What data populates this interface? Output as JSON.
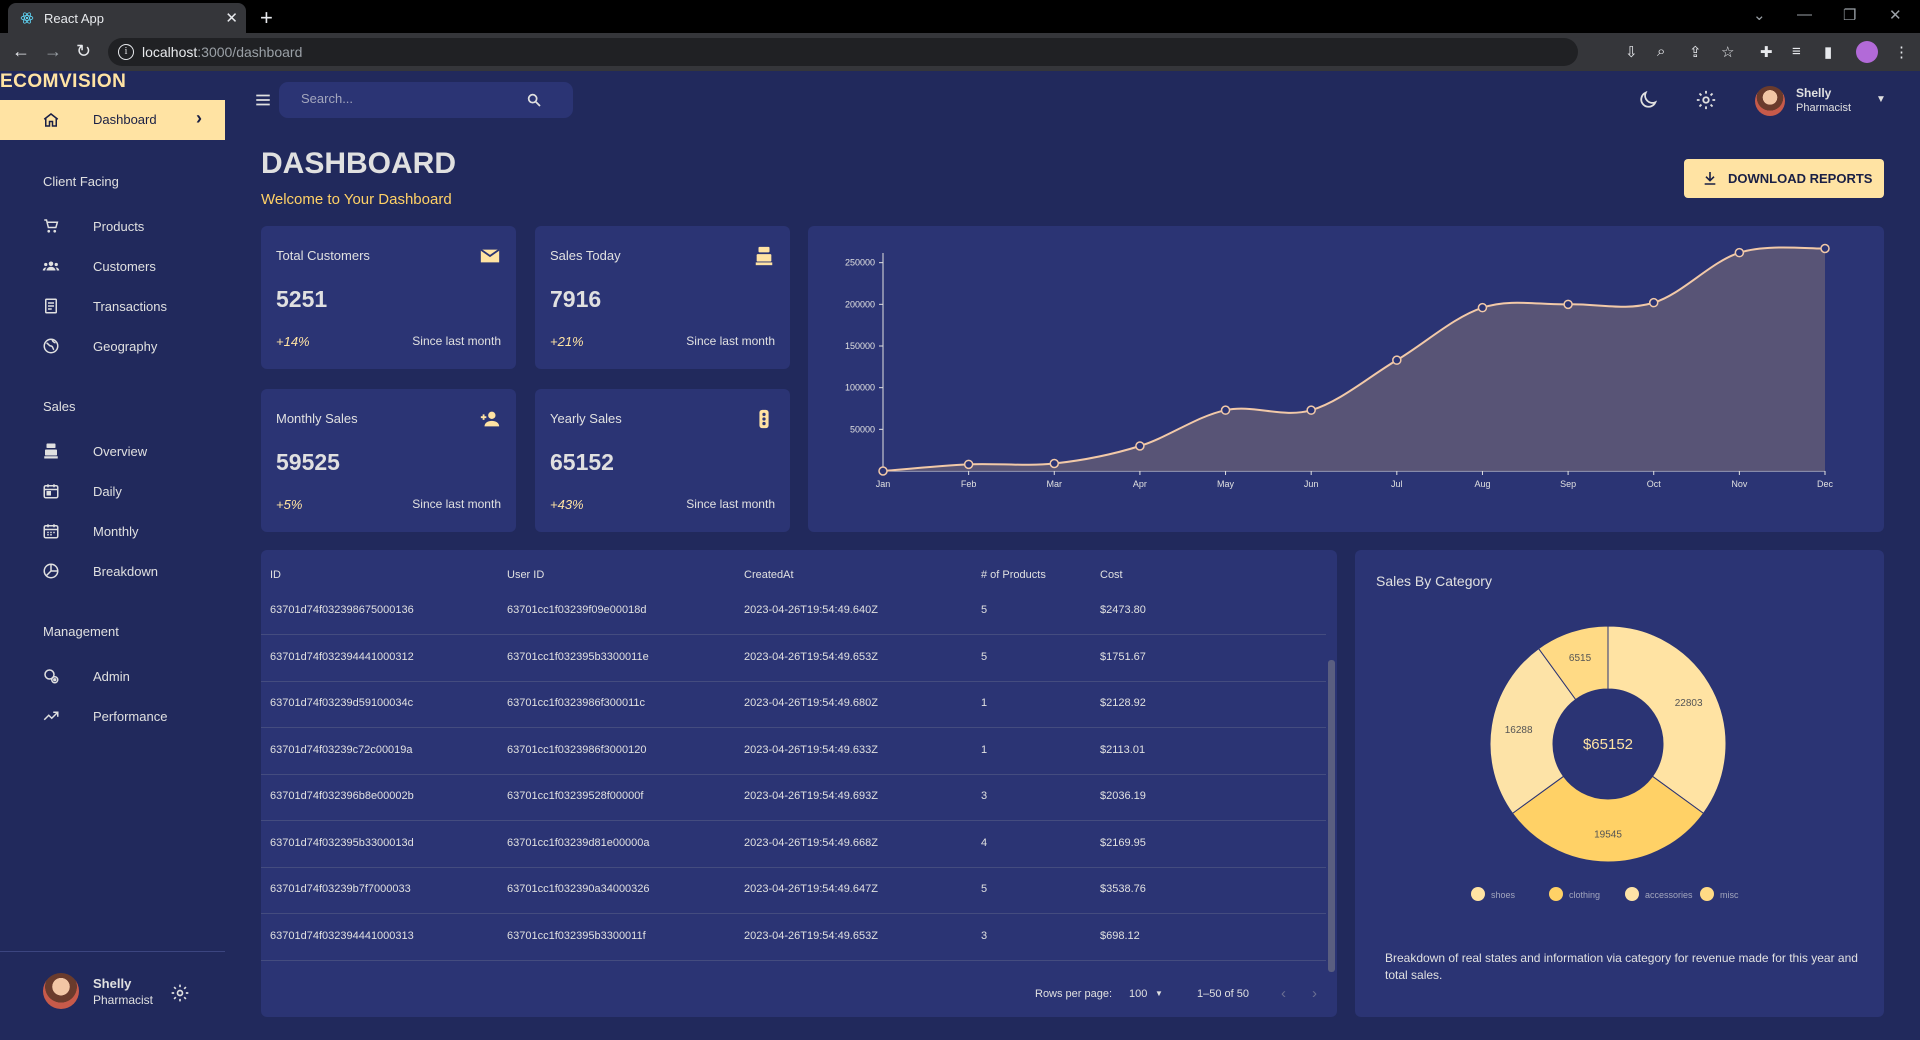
{
  "browser": {
    "tab_title": "React App",
    "url_host": "localhost",
    "url_path": ":3000/dashboard"
  },
  "sidebar": {
    "brand": "ECOMVISION",
    "active": {
      "label": "Dashboard",
      "icon": "home-icon"
    },
    "sections": [
      {
        "title": "Client Facing",
        "items": [
          {
            "label": "Products",
            "icon": "cart-icon"
          },
          {
            "label": "Customers",
            "icon": "groups-icon"
          },
          {
            "label": "Transactions",
            "icon": "receipt-icon"
          },
          {
            "label": "Geography",
            "icon": "globe-icon"
          }
        ]
      },
      {
        "title": "Sales",
        "items": [
          {
            "label": "Overview",
            "icon": "point-of-sale-icon"
          },
          {
            "label": "Daily",
            "icon": "calendar-today-icon"
          },
          {
            "label": "Monthly",
            "icon": "calendar-month-icon"
          },
          {
            "label": "Breakdown",
            "icon": "pie-chart-icon"
          }
        ]
      },
      {
        "title": "Management",
        "items": [
          {
            "label": "Admin",
            "icon": "admin-icon"
          },
          {
            "label": "Performance",
            "icon": "trending-up-icon"
          }
        ]
      }
    ],
    "user": {
      "name": "Shelly",
      "role": "Pharmacist"
    }
  },
  "topbar": {
    "search_placeholder": "Search...",
    "user": {
      "name": "Shelly",
      "role": "Pharmacist"
    }
  },
  "header": {
    "title": "DASHBOARD",
    "subtitle": "Welcome to Your Dashboard",
    "download_label": "DOWNLOAD REPORTS"
  },
  "stats": [
    {
      "title": "Total Customers",
      "value": "5251",
      "change": "+14%",
      "since": "Since last month",
      "icon": "email-icon"
    },
    {
      "title": "Sales Today",
      "value": "7916",
      "change": "+21%",
      "since": "Since last month",
      "icon": "point-of-sale-icon"
    },
    {
      "title": "Monthly Sales",
      "value": "59525",
      "change": "+5%",
      "since": "Since last month",
      "icon": "person-add-icon"
    },
    {
      "title": "Yearly Sales",
      "value": "65152",
      "change": "+43%",
      "since": "Since last month",
      "icon": "traffic-icon"
    }
  ],
  "chart_data": [
    {
      "type": "area",
      "categories": [
        "Jan",
        "Feb",
        "Mar",
        "Apr",
        "May",
        "Jun",
        "Jul",
        "Aug",
        "Sep",
        "Oct",
        "Nov",
        "Dec"
      ],
      "values": [
        0,
        8000,
        9000,
        30000,
        73000,
        73000,
        133000,
        196000,
        200000,
        202000,
        262000,
        267000
      ],
      "yticks": [
        50000,
        100000,
        150000,
        200000,
        250000
      ],
      "ylim": [
        0,
        270000
      ],
      "title": "",
      "xlabel": "",
      "ylabel": "",
      "color": "#ffe3a3"
    },
    {
      "type": "pie",
      "title": "Sales By Category",
      "center_label": "$65152",
      "slices": [
        {
          "name": "shoes",
          "value": 22803,
          "color": "#ffe3a3"
        },
        {
          "name": "clothing",
          "value": 19545,
          "color": "#ffd166"
        },
        {
          "name": "accessories",
          "value": 16288,
          "color": "#fde3a7"
        },
        {
          "name": "misc",
          "value": 6515,
          "color": "#ffda85"
        }
      ],
      "legend": [
        "shoes",
        "clothing",
        "accessories",
        "misc"
      ],
      "legend_position": "bottom"
    }
  ],
  "transactions": {
    "columns": [
      "ID",
      "User ID",
      "CreatedAt",
      "# of Products",
      "Cost"
    ],
    "rows": [
      [
        "63701d74f032398675000136",
        "63701cc1f03239f09e00018d",
        "2023-04-26T19:54:49.640Z",
        "5",
        "$2473.80"
      ],
      [
        "63701d74f032394441000312",
        "63701cc1f032395b3300011e",
        "2023-04-26T19:54:49.653Z",
        "5",
        "$1751.67"
      ],
      [
        "63701d74f03239d59100034c",
        "63701cc1f0323986f300011c",
        "2023-04-26T19:54:49.680Z",
        "1",
        "$2128.92"
      ],
      [
        "63701d74f03239c72c00019a",
        "63701cc1f0323986f3000120",
        "2023-04-26T19:54:49.633Z",
        "1",
        "$2113.01"
      ],
      [
        "63701d74f032396b8e00002b",
        "63701cc1f03239528f00000f",
        "2023-04-26T19:54:49.693Z",
        "3",
        "$2036.19"
      ],
      [
        "63701d74f032395b3300013d",
        "63701cc1f03239d81e00000a",
        "2023-04-26T19:54:49.668Z",
        "4",
        "$2169.95"
      ],
      [
        "63701d74f03239b7f7000033",
        "63701cc1f032390a34000326",
        "2023-04-26T19:54:49.647Z",
        "5",
        "$3538.76"
      ],
      [
        "63701d74f032394441000313",
        "63701cc1f032395b3300011f",
        "2023-04-26T19:54:49.653Z",
        "3",
        "$698.12"
      ]
    ],
    "rows_per_page_label": "Rows per page:",
    "rows_per_page": "100",
    "page_range": "1–50 of 50"
  },
  "category_desc": "Breakdown of real states and information via category for revenue made for this year and total sales."
}
